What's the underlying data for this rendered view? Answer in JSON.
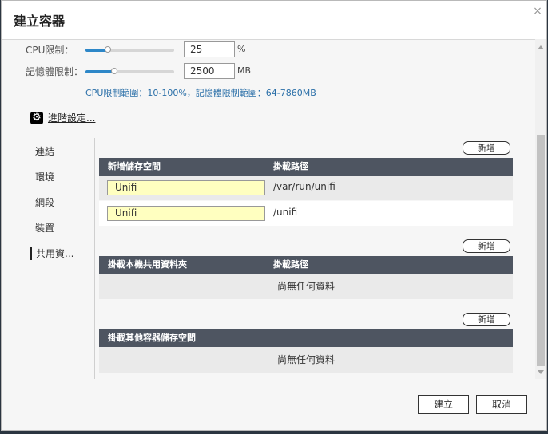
{
  "dialog": {
    "title": "建立容器",
    "close_glyph": "×"
  },
  "resources": {
    "cpu": {
      "label": "CPU限制：",
      "value": "25",
      "unit": "%",
      "level_percent": 25
    },
    "memory": {
      "label": "記憶體限制：",
      "value": "2500",
      "unit": "MB",
      "level_percent": 32
    },
    "range_note": "CPU限制範圍：10-100%，記憶體限制範圍：64-7860MB"
  },
  "advanced": {
    "icon": "gear-icon",
    "label": "進階設定..."
  },
  "sidenav": {
    "items": [
      "連結",
      "環境",
      "網段",
      "裝置",
      "共用資..."
    ],
    "active_index": 4
  },
  "storage": {
    "add_label": "新增",
    "new_volume_table": {
      "headers": [
        "新增儲存空間",
        "掛載路徑"
      ],
      "rows": [
        {
          "volume": "Unifi",
          "path": "/var/run/unifi"
        },
        {
          "volume": "Unifi",
          "path": "/unifi"
        }
      ]
    },
    "host_folder_table": {
      "add_label": "新增",
      "headers": [
        "掛載本機共用資料夾",
        "掛載路徑"
      ],
      "empty": "尚無任何資料"
    },
    "other_container_table": {
      "add_label": "新增",
      "headers": [
        "掛載其他容器儲存空間"
      ],
      "empty": "尚無任何資料"
    }
  },
  "footer": {
    "create_label": "建立",
    "cancel_label": "取消"
  },
  "colors": {
    "accent": "#2d87c8",
    "table_header": "#4e5561",
    "input_highlight": "#ffffc0",
    "note_text": "#2a6fa8"
  }
}
